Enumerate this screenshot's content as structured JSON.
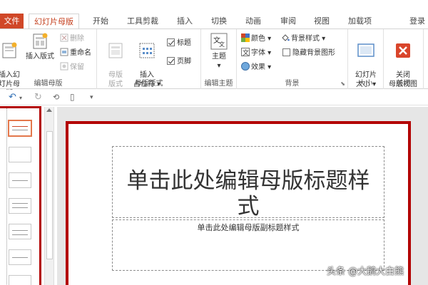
{
  "tabs": {
    "file": "文件",
    "slide_master": "幻灯片母版",
    "home": "开始",
    "toolbox": "工具剪裁",
    "insert": "插入",
    "transitions": "切换",
    "animations": "动画",
    "review": "审阅",
    "view": "视图",
    "addins": "加载项",
    "login": "登录"
  },
  "ribbon": {
    "edit_master": {
      "label": "编辑母版",
      "insert_slide_master": "插入幻\n灯片母版",
      "insert_layout": "插入版式",
      "delete": "删除",
      "rename": "重命名",
      "preserve": "保留"
    },
    "master_layout": {
      "label": "母版版式",
      "master_layout_btn": "母版\n版式",
      "insert_placeholder": "插入\n占位符",
      "title": "标题",
      "footer": "页脚"
    },
    "edit_theme": {
      "label": "编辑主题",
      "themes": "主题"
    },
    "background": {
      "label": "背景",
      "colors": "颜色",
      "fonts": "字体",
      "effects": "效果",
      "background_styles": "背景样式",
      "hide_background": "隐藏背景图形"
    },
    "size": {
      "label": "大小",
      "slide_size": "幻灯片\n大小"
    },
    "close": {
      "label": "关闭",
      "close_master_view": "关闭\n母版视图"
    }
  },
  "slide": {
    "title_placeholder": "单击此处编辑母版标题样式",
    "subtitle_placeholder": "单击此处编辑母版副标题样式"
  },
  "watermark": "头条 @大鹅大白熊",
  "colors": {
    "accent": "#c43e1c",
    "file_tab": "#d04727",
    "highlight_border": "#b30000"
  }
}
